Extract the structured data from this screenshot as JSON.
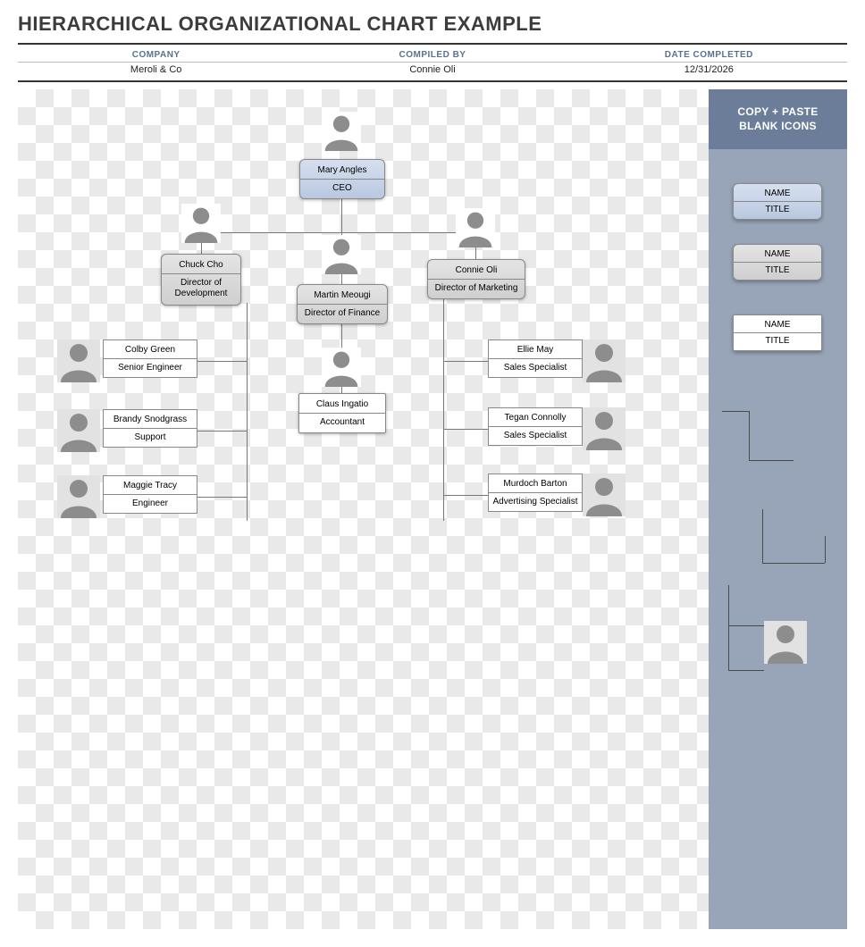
{
  "header": {
    "title": "HIERARCHICAL ORGANIZATIONAL CHART EXAMPLE",
    "columns": {
      "company_h": "COMPANY",
      "compiled_h": "COMPILED BY",
      "date_h": "DATE COMPLETED",
      "company": "Meroli & Co",
      "compiled": "Connie Oli",
      "date": "12/31/2026"
    }
  },
  "sidebar": {
    "header_l1": "COPY + PASTE",
    "header_l2": "BLANK ICONS",
    "templates": [
      {
        "name": "NAME",
        "title": "TITLE"
      },
      {
        "name": "NAME",
        "title": "TITLE"
      },
      {
        "name": "NAME",
        "title": "TITLE"
      }
    ]
  },
  "chart": {
    "ceo": {
      "name": "Mary Angles",
      "title": "CEO"
    },
    "dev_dir": {
      "name": "Chuck Cho",
      "title": "Director of Development"
    },
    "fin_dir": {
      "name": "Martin Meougi",
      "title": "Director of Finance"
    },
    "mkt_dir": {
      "name": "Connie Oli",
      "title": "Director of Marketing"
    },
    "accountant": {
      "name": "Claus Ingatio",
      "title": "Accountant"
    },
    "dev_staff": [
      {
        "name": "Colby Green",
        "title": "Senior Engineer"
      },
      {
        "name": "Brandy Snodgrass",
        "title": "Support"
      },
      {
        "name": "Maggie Tracy",
        "title": "Engineer"
      }
    ],
    "mkt_staff": [
      {
        "name": "Ellie May",
        "title": "Sales Specialist"
      },
      {
        "name": "Tegan Connolly",
        "title": "Sales Specialist"
      },
      {
        "name": "Murdoch Barton",
        "title": "Advertising Specialist"
      }
    ]
  },
  "chart_data": {
    "type": "org-tree",
    "root": {
      "name": "Mary Angles",
      "title": "CEO",
      "children": [
        {
          "name": "Chuck Cho",
          "title": "Director of Development",
          "children": [
            {
              "name": "Colby Green",
              "title": "Senior Engineer"
            },
            {
              "name": "Brandy Snodgrass",
              "title": "Support"
            },
            {
              "name": "Maggie Tracy",
              "title": "Engineer"
            }
          ]
        },
        {
          "name": "Martin Meougi",
          "title": "Director of Finance",
          "children": [
            {
              "name": "Claus Ingatio",
              "title": "Accountant"
            }
          ]
        },
        {
          "name": "Connie Oli",
          "title": "Director of Marketing",
          "children": [
            {
              "name": "Ellie May",
              "title": "Sales Specialist"
            },
            {
              "name": "Tegan Connolly",
              "title": "Sales Specialist"
            },
            {
              "name": "Murdoch Barton",
              "title": "Advertising Specialist"
            }
          ]
        }
      ]
    }
  }
}
